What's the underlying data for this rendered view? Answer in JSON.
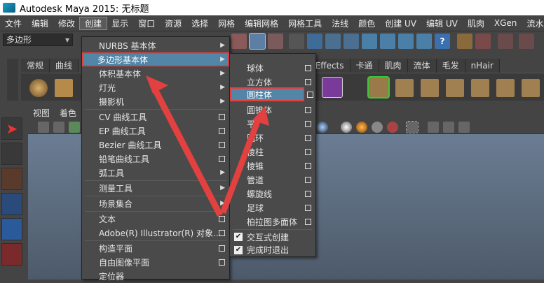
{
  "title": "Autodesk Maya 2015: 无标题",
  "menubar": [
    "文件",
    "编辑",
    "修改",
    "创建",
    "显示",
    "窗口",
    "资源",
    "选择",
    "网格",
    "编辑网格",
    "网格工具",
    "法线",
    "颜色",
    "创建 UV",
    "编辑 UV",
    "肌肉",
    "XGen",
    "流水"
  ],
  "mode_selector": "多边形",
  "shelf_tabs": [
    "常规",
    "曲线",
    "PaintEffects",
    "卡通",
    "肌肉",
    "流体",
    "毛发",
    "nHair"
  ],
  "panel_menu": [
    "视图",
    "着色"
  ],
  "create_menu": {
    "items": [
      {
        "label": "NURBS 基本体",
        "kind": "submenu"
      },
      {
        "label": "多边形基本体",
        "kind": "submenu"
      },
      {
        "label": "体积基本体",
        "kind": "submenu"
      },
      {
        "label": "灯光",
        "kind": "submenu"
      },
      {
        "label": "摄影机",
        "kind": "submenu"
      },
      {
        "label": "CV 曲线工具",
        "kind": "option"
      },
      {
        "label": "EP 曲线工具",
        "kind": "option"
      },
      {
        "label": "Bezier 曲线工具",
        "kind": "option"
      },
      {
        "label": "铅笔曲线工具",
        "kind": "option"
      },
      {
        "label": "弧工具",
        "kind": "submenu"
      },
      {
        "label": "测量工具",
        "kind": "submenu"
      },
      {
        "label": "场景集合",
        "kind": "submenu"
      },
      {
        "label": "文本",
        "kind": "option"
      },
      {
        "label": "Adobe(R) Illustrator(R) 对象...",
        "kind": "option"
      },
      {
        "label": "构造平面",
        "kind": "option"
      },
      {
        "label": "自由图像平面",
        "kind": "option"
      },
      {
        "label": "定位器",
        "kind": "plain"
      }
    ]
  },
  "poly_submenu": {
    "items": [
      {
        "label": "球体"
      },
      {
        "label": "立方体"
      },
      {
        "label": "圆柱体"
      },
      {
        "label": "圆锥体"
      },
      {
        "label": "平"
      },
      {
        "label": "圆环"
      },
      {
        "label": "棱柱"
      },
      {
        "label": "棱锥"
      },
      {
        "label": "管道"
      },
      {
        "label": "螺旋线"
      },
      {
        "label": "足球"
      },
      {
        "label": "柏拉图多面体"
      }
    ],
    "checks": [
      {
        "label": "交互式创建",
        "checked": true
      },
      {
        "label": "完成时退出",
        "checked": true
      }
    ]
  },
  "colors": {
    "highlight": "#5285a6",
    "annotation": "#e34040"
  }
}
